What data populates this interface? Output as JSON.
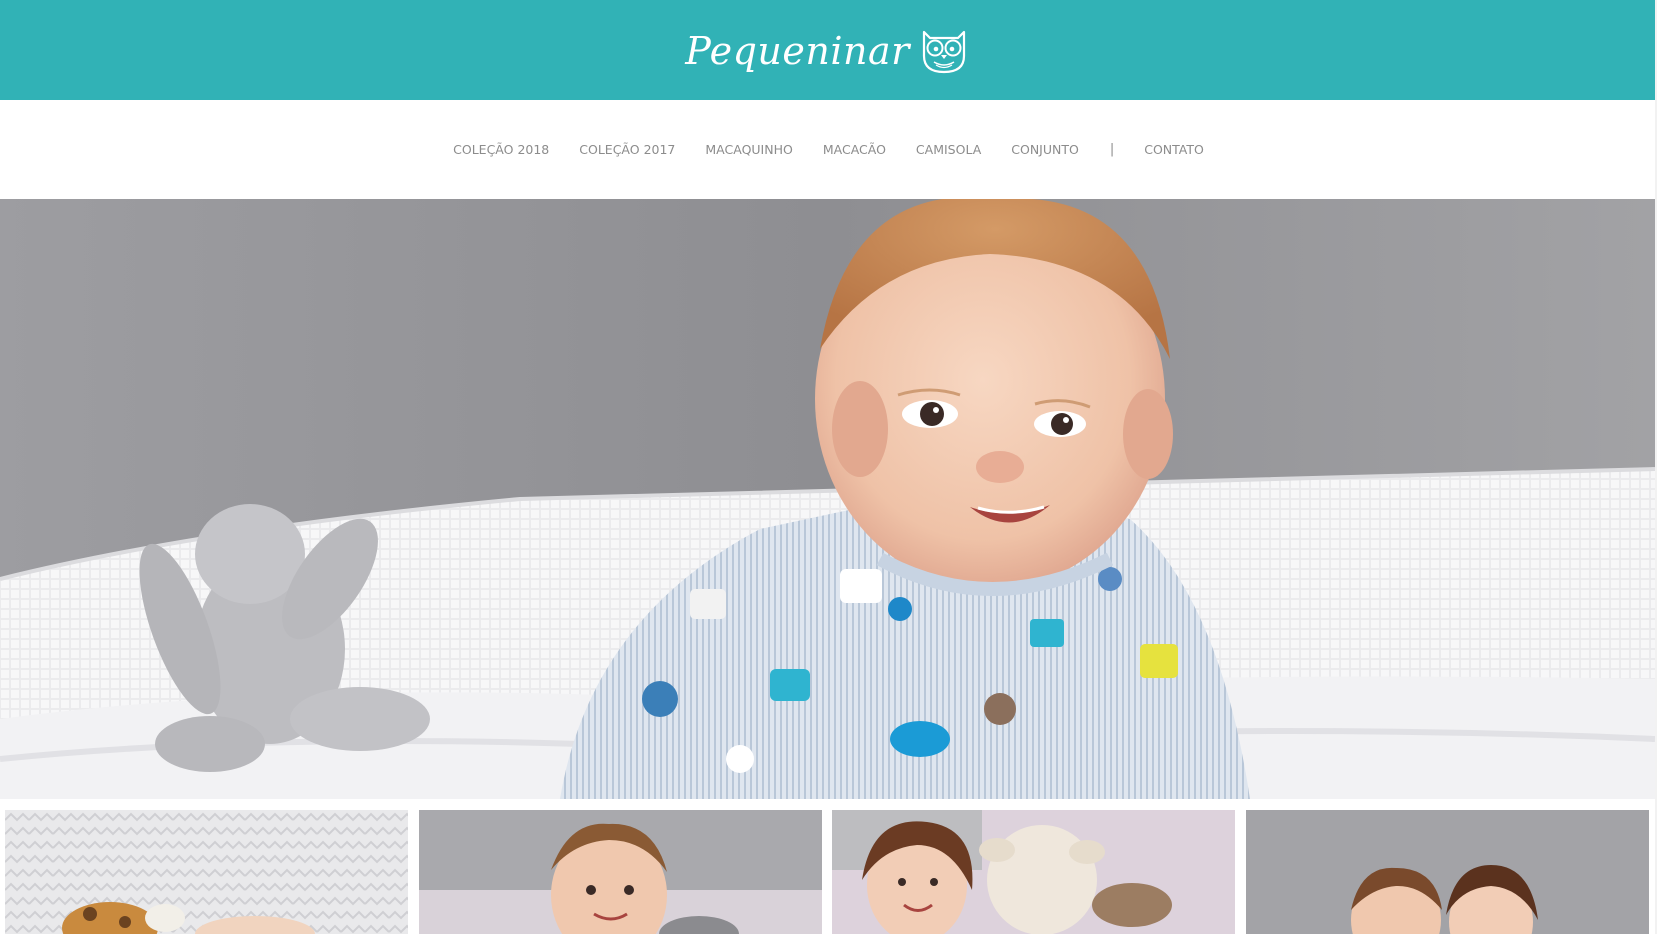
{
  "header": {
    "brand": "Pequeninar",
    "logo_icon": "owl-icon",
    "background_color": "#31b2b6"
  },
  "nav": {
    "items": [
      {
        "label": "COLEÇÃO 2018"
      },
      {
        "label": "COLEÇÃO 2017"
      },
      {
        "label": "MACAQUINHO"
      },
      {
        "label": "MACACÃO"
      },
      {
        "label": "CAMISOLA"
      },
      {
        "label": "CONJUNTO"
      }
    ],
    "separator": "|",
    "contact": "CONTATO",
    "text_color": "#8c8c8c"
  },
  "hero": {
    "image": "baby-in-printed-romper-with-plush-bunny"
  },
  "gallery": {
    "thumbnails": [
      {
        "image": "baby-lying-with-giraffe-plush"
      },
      {
        "image": "smiling-baby-boy-sitting"
      },
      {
        "image": "girl-hugging-lamb-plush"
      },
      {
        "image": "two-children-together"
      }
    ]
  }
}
